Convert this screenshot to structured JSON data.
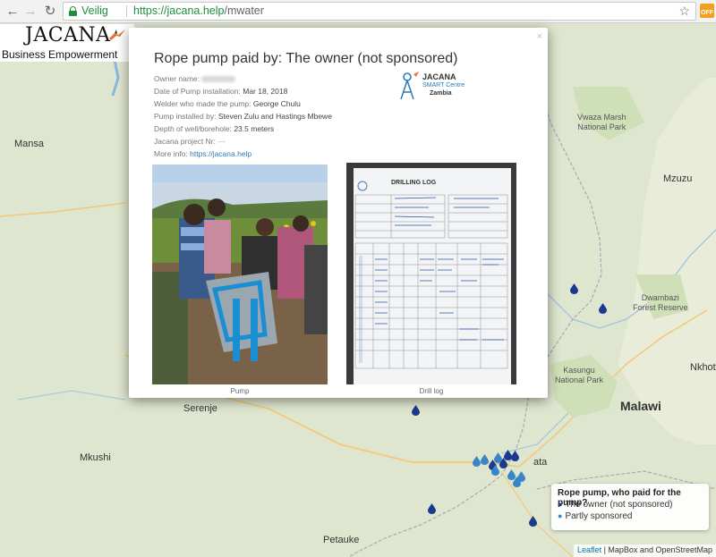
{
  "browser": {
    "secure_label": "Veilig",
    "url_host": "https://jacana.help",
    "url_path": "/mwater",
    "ext_badge": "OFF"
  },
  "logo": {
    "title": "JACANA",
    "subtitle": "Business Empowerment"
  },
  "popup": {
    "title": "Rope pump paid by: The owner (not sponsored)",
    "close": "×",
    "owner_label": "Owner name:",
    "date_label": "Date of Pump installation:",
    "date_value": "Mar 18, 2018",
    "welder_label": "Welder who made the pump:",
    "welder_value": "George Chulu",
    "installer_label": "Pump installed by:",
    "installer_value": "Steven Zulu and Hastings Mbewe",
    "depth_label": "Depth of well/borehole:",
    "depth_value": "23.5 meters",
    "project_label": "Jacana project Nr:",
    "project_value": "---",
    "more_label": "More info:",
    "more_link": "https://jacana.help",
    "logo_name": "JACANA",
    "logo_line1": "SMART Centre",
    "logo_line2": "Zambia",
    "photo1_caption": "Pump",
    "photo2_caption": "Drill log",
    "drill_log_heading": "DRILLING LOG"
  },
  "map": {
    "places": [
      "Mansa",
      "Mzuzu",
      "Vwaza Marsh\nNational Park",
      "Dwambazi\nForest Reserve",
      "Kasungu\nNational Park",
      "Nkhot",
      "Malawi",
      "Serenje",
      "Mkushi",
      "Petauke",
      "ata"
    ]
  },
  "legend": {
    "title": "Rope pump, who paid for the pump?",
    "item1": "The owner (not sponsored)",
    "item2": "Partly sponsored"
  },
  "attribution": {
    "leaflet": "Leaflet",
    "rest": " | MapBox and OpenStreetMap"
  },
  "colors": {
    "pin_owner": "#1a3a8f",
    "pin_partly": "#3a85c8",
    "secure_green": "#1e8e3e"
  }
}
